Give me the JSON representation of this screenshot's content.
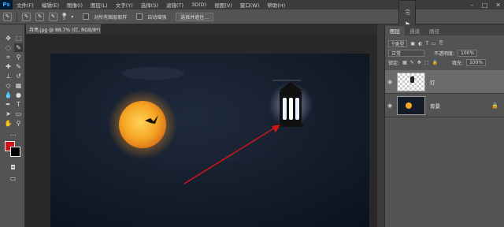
{
  "app": {
    "logo": "Ps"
  },
  "menu": [
    "文件(F)",
    "编辑(E)",
    "图像(I)",
    "图层(L)",
    "文字(Y)",
    "选择(S)",
    "滤镜(T)",
    "3D(D)",
    "视图(V)",
    "窗口(W)",
    "帮助(H)"
  ],
  "window_controls": {
    "minimize": "–",
    "maximize": "□",
    "close": "✕"
  },
  "options": {
    "brush_size": "5",
    "sample_all_layers": "对所有图层取样",
    "auto_enhance": "自动增强",
    "refine_edge": "选择并遮住..."
  },
  "document": {
    "tab_title": "月亮.jpg @ 88.7% (灯, RGB/8*) *",
    "close": "×"
  },
  "colors": {
    "foreground": "#d0141a",
    "background": "#000000",
    "arrow": "#d0141a",
    "moon": "#f5a623"
  },
  "panel": {
    "tabs": [
      "图层",
      "通道",
      "路径"
    ],
    "filter_kind": "类型",
    "blend_mode": "正常",
    "opacity_label": "不透明度:",
    "opacity_value": "100%",
    "lock_label": "锁定:",
    "fill_label": "填充:",
    "fill_value": "100%",
    "layers": [
      {
        "name": "灯",
        "selected": true
      },
      {
        "name": "背景",
        "selected": false,
        "locked": true
      }
    ]
  }
}
